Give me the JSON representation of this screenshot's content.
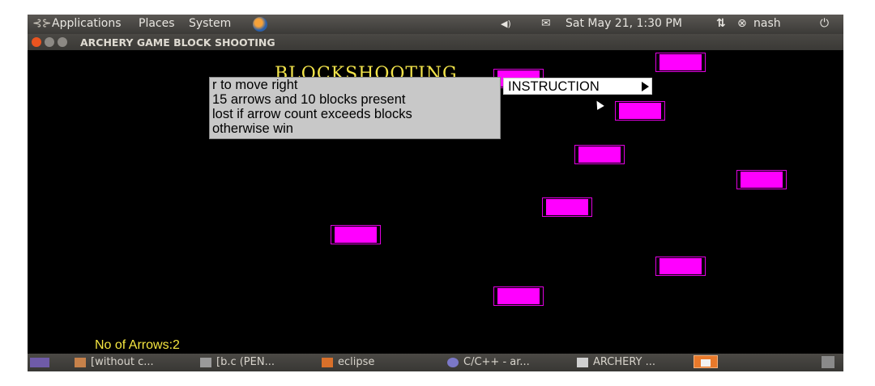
{
  "top_panel": {
    "menus": [
      "Applications",
      "Places",
      "System"
    ],
    "clock": "Sat May 21,  1:30 PM",
    "user": "nash"
  },
  "window": {
    "title": "ARCHERY GAME BLOCK SHOOTING"
  },
  "game": {
    "title": "BLOCKSHOOTING",
    "instructions": [
      "r to move right",
      "15 arrows and 10 blocks present",
      "lost if arrow count exceeds blocks",
      "otherwise win"
    ],
    "menu_label": "INSTRUCTION",
    "arrows_label": "No of Arrows:2",
    "block_color": "#ff00ff"
  },
  "taskbar": {
    "items": [
      "[without c...",
      "[b.c (PEN...",
      "eclipse",
      "C/C++ - ar...",
      "ARCHERY ..."
    ]
  }
}
